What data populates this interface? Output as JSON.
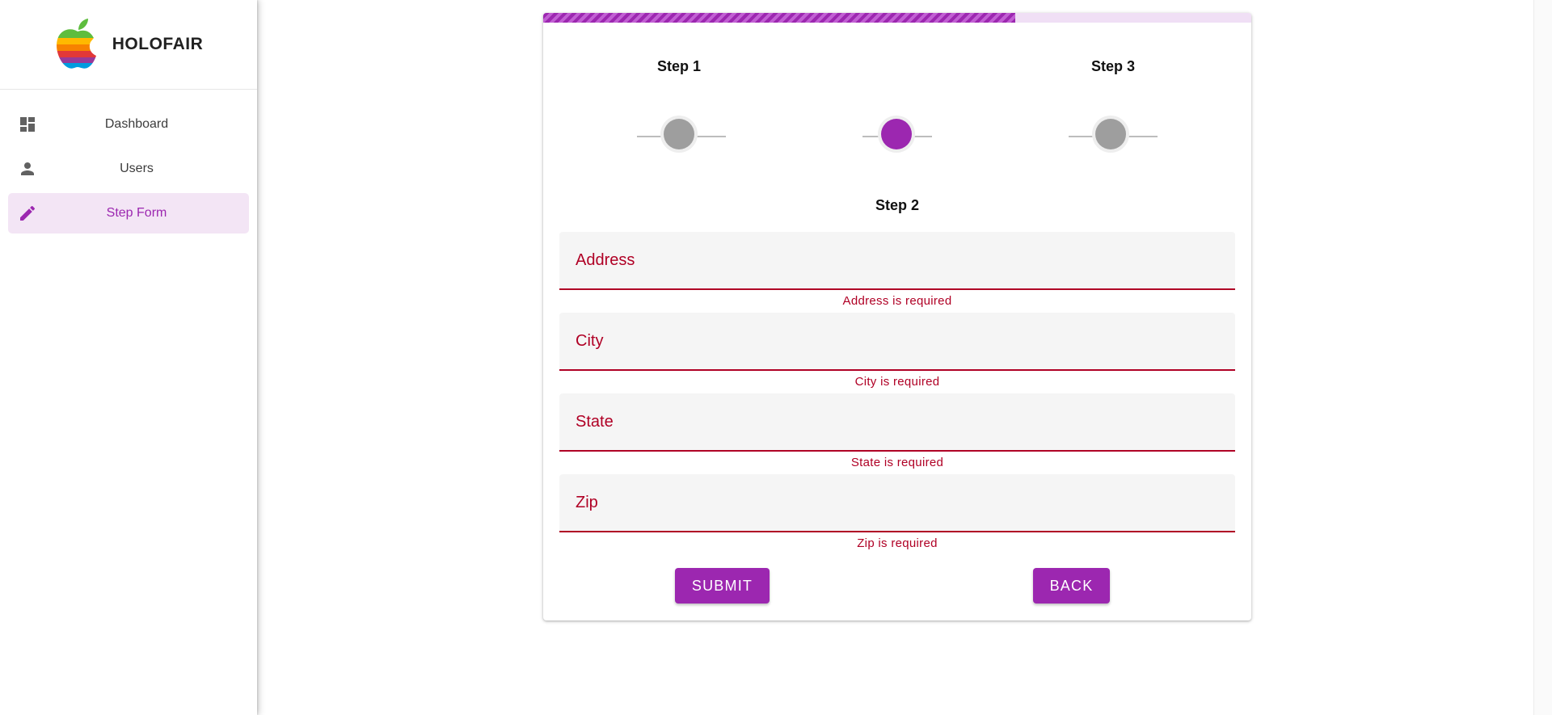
{
  "app": {
    "name": "HOLOFAIR"
  },
  "sidebar": {
    "items": [
      {
        "label": "Dashboard",
        "icon": "dashboard-icon"
      },
      {
        "label": "Users",
        "icon": "person-icon"
      },
      {
        "label": "Step Form",
        "icon": "pencil-icon",
        "active": true
      }
    ]
  },
  "form": {
    "progress": 0.667,
    "steps": [
      {
        "label": "Step 1",
        "state": "inactive"
      },
      {
        "label": "Step 2",
        "state": "active"
      },
      {
        "label": "Step 3",
        "state": "inactive"
      }
    ],
    "current_step_label": "Step 2",
    "fields": [
      {
        "placeholder": "Address",
        "value": "",
        "error": "Address is required"
      },
      {
        "placeholder": "City",
        "value": "",
        "error": "City is required"
      },
      {
        "placeholder": "State",
        "value": "",
        "error": "State is required"
      },
      {
        "placeholder": "Zip",
        "value": "",
        "error": "Zip is required"
      }
    ],
    "submit_label": "SUBMIT",
    "back_label": "BACK"
  },
  "colors": {
    "accent": "#9c27b0",
    "error": "#b00025",
    "active_nav_bg": "#f3e5f5"
  }
}
